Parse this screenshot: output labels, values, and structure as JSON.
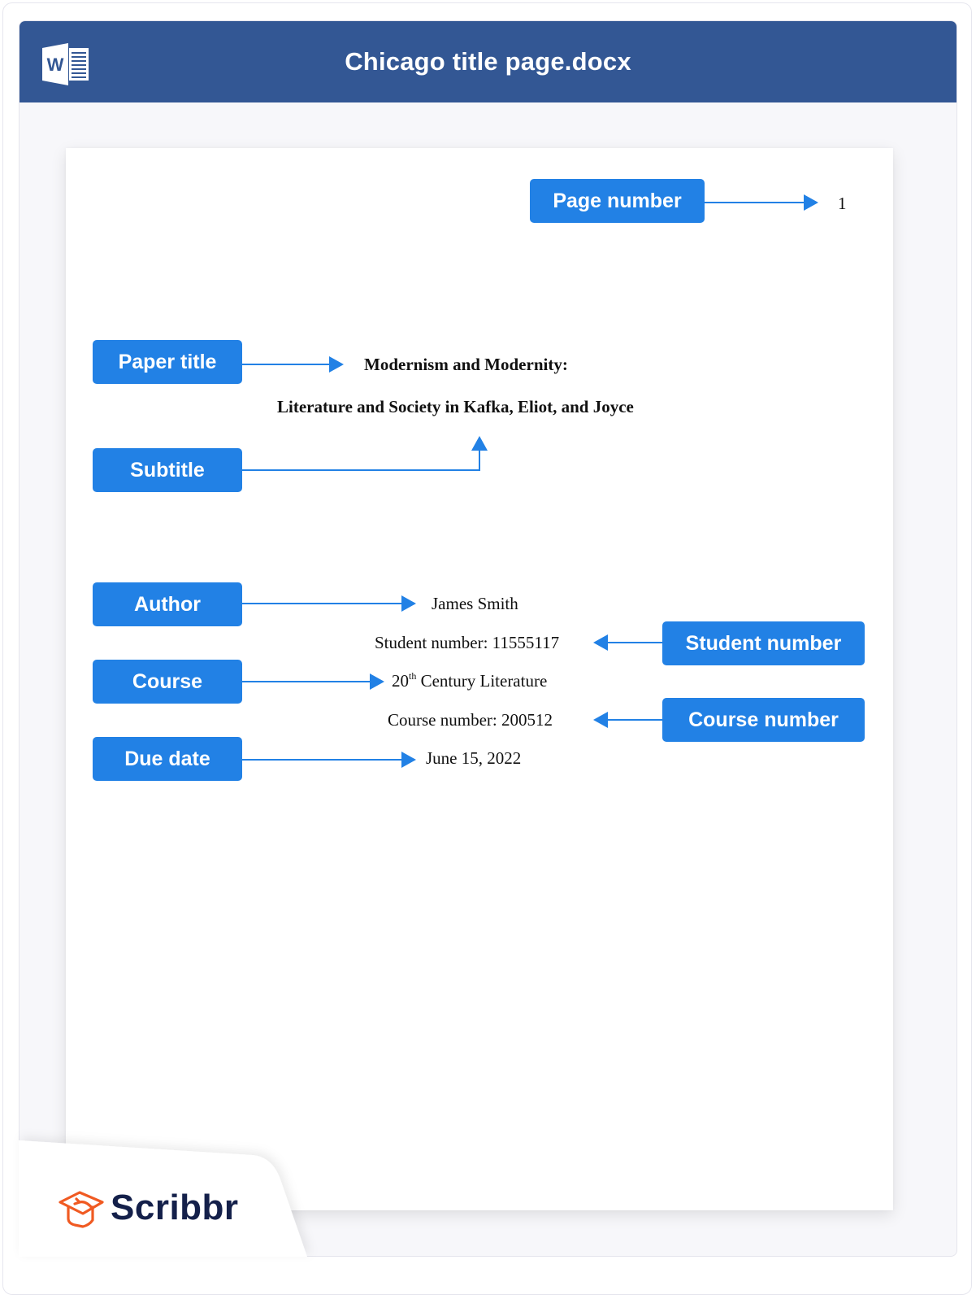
{
  "window": {
    "title": "Chicago title page.docx",
    "app_icon": "word-icon",
    "titlebar_color": "#335794"
  },
  "annotations": {
    "color": "#2281e5",
    "page_number": "Page number",
    "paper_title": "Paper title",
    "subtitle": "Subtitle",
    "author": "Author",
    "student_number": "Student number",
    "course": "Course",
    "course_number": "Course number",
    "due_date": "Due date"
  },
  "document": {
    "page_number": "1",
    "title": "Modernism and Modernity:",
    "subtitle": "Literature and Society in Kafka, Eliot, and Joyce",
    "author": "James Smith",
    "student_number": "Student number: 11555117",
    "course_prefix": "20",
    "course_superscript": "th",
    "course_suffix": " Century Literature",
    "course_number": "Course number: 200512",
    "due_date": "June 15, 2022"
  },
  "brand": {
    "name": "Scribbr",
    "logo": "graduation-cap-icon",
    "logo_color": "#f05a22",
    "text_color": "#14204a"
  }
}
